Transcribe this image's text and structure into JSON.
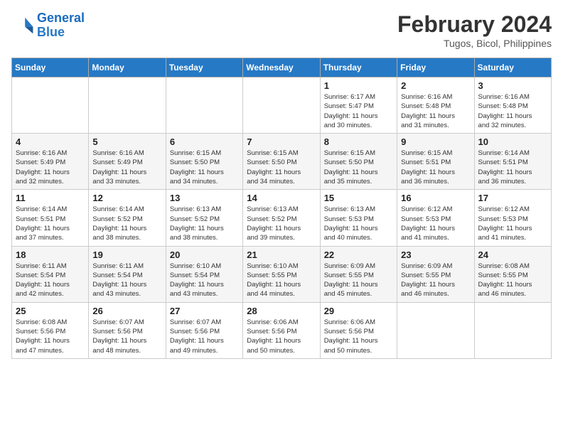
{
  "header": {
    "logo_text_normal": "General",
    "logo_text_blue": "Blue",
    "main_title": "February 2024",
    "subtitle": "Tugos, Bicol, Philippines"
  },
  "columns": [
    "Sunday",
    "Monday",
    "Tuesday",
    "Wednesday",
    "Thursday",
    "Friday",
    "Saturday"
  ],
  "weeks": [
    [
      {
        "day": "",
        "info": ""
      },
      {
        "day": "",
        "info": ""
      },
      {
        "day": "",
        "info": ""
      },
      {
        "day": "",
        "info": ""
      },
      {
        "day": "1",
        "info": "Sunrise: 6:17 AM\nSunset: 5:47 PM\nDaylight: 11 hours\nand 30 minutes."
      },
      {
        "day": "2",
        "info": "Sunrise: 6:16 AM\nSunset: 5:48 PM\nDaylight: 11 hours\nand 31 minutes."
      },
      {
        "day": "3",
        "info": "Sunrise: 6:16 AM\nSunset: 5:48 PM\nDaylight: 11 hours\nand 32 minutes."
      }
    ],
    [
      {
        "day": "4",
        "info": "Sunrise: 6:16 AM\nSunset: 5:49 PM\nDaylight: 11 hours\nand 32 minutes."
      },
      {
        "day": "5",
        "info": "Sunrise: 6:16 AM\nSunset: 5:49 PM\nDaylight: 11 hours\nand 33 minutes."
      },
      {
        "day": "6",
        "info": "Sunrise: 6:15 AM\nSunset: 5:50 PM\nDaylight: 11 hours\nand 34 minutes."
      },
      {
        "day": "7",
        "info": "Sunrise: 6:15 AM\nSunset: 5:50 PM\nDaylight: 11 hours\nand 34 minutes."
      },
      {
        "day": "8",
        "info": "Sunrise: 6:15 AM\nSunset: 5:50 PM\nDaylight: 11 hours\nand 35 minutes."
      },
      {
        "day": "9",
        "info": "Sunrise: 6:15 AM\nSunset: 5:51 PM\nDaylight: 11 hours\nand 36 minutes."
      },
      {
        "day": "10",
        "info": "Sunrise: 6:14 AM\nSunset: 5:51 PM\nDaylight: 11 hours\nand 36 minutes."
      }
    ],
    [
      {
        "day": "11",
        "info": "Sunrise: 6:14 AM\nSunset: 5:51 PM\nDaylight: 11 hours\nand 37 minutes."
      },
      {
        "day": "12",
        "info": "Sunrise: 6:14 AM\nSunset: 5:52 PM\nDaylight: 11 hours\nand 38 minutes."
      },
      {
        "day": "13",
        "info": "Sunrise: 6:13 AM\nSunset: 5:52 PM\nDaylight: 11 hours\nand 38 minutes."
      },
      {
        "day": "14",
        "info": "Sunrise: 6:13 AM\nSunset: 5:52 PM\nDaylight: 11 hours\nand 39 minutes."
      },
      {
        "day": "15",
        "info": "Sunrise: 6:13 AM\nSunset: 5:53 PM\nDaylight: 11 hours\nand 40 minutes."
      },
      {
        "day": "16",
        "info": "Sunrise: 6:12 AM\nSunset: 5:53 PM\nDaylight: 11 hours\nand 41 minutes."
      },
      {
        "day": "17",
        "info": "Sunrise: 6:12 AM\nSunset: 5:53 PM\nDaylight: 11 hours\nand 41 minutes."
      }
    ],
    [
      {
        "day": "18",
        "info": "Sunrise: 6:11 AM\nSunset: 5:54 PM\nDaylight: 11 hours\nand 42 minutes."
      },
      {
        "day": "19",
        "info": "Sunrise: 6:11 AM\nSunset: 5:54 PM\nDaylight: 11 hours\nand 43 minutes."
      },
      {
        "day": "20",
        "info": "Sunrise: 6:10 AM\nSunset: 5:54 PM\nDaylight: 11 hours\nand 43 minutes."
      },
      {
        "day": "21",
        "info": "Sunrise: 6:10 AM\nSunset: 5:55 PM\nDaylight: 11 hours\nand 44 minutes."
      },
      {
        "day": "22",
        "info": "Sunrise: 6:09 AM\nSunset: 5:55 PM\nDaylight: 11 hours\nand 45 minutes."
      },
      {
        "day": "23",
        "info": "Sunrise: 6:09 AM\nSunset: 5:55 PM\nDaylight: 11 hours\nand 46 minutes."
      },
      {
        "day": "24",
        "info": "Sunrise: 6:08 AM\nSunset: 5:55 PM\nDaylight: 11 hours\nand 46 minutes."
      }
    ],
    [
      {
        "day": "25",
        "info": "Sunrise: 6:08 AM\nSunset: 5:56 PM\nDaylight: 11 hours\nand 47 minutes."
      },
      {
        "day": "26",
        "info": "Sunrise: 6:07 AM\nSunset: 5:56 PM\nDaylight: 11 hours\nand 48 minutes."
      },
      {
        "day": "27",
        "info": "Sunrise: 6:07 AM\nSunset: 5:56 PM\nDaylight: 11 hours\nand 49 minutes."
      },
      {
        "day": "28",
        "info": "Sunrise: 6:06 AM\nSunset: 5:56 PM\nDaylight: 11 hours\nand 50 minutes."
      },
      {
        "day": "29",
        "info": "Sunrise: 6:06 AM\nSunset: 5:56 PM\nDaylight: 11 hours\nand 50 minutes."
      },
      {
        "day": "",
        "info": ""
      },
      {
        "day": "",
        "info": ""
      }
    ]
  ]
}
